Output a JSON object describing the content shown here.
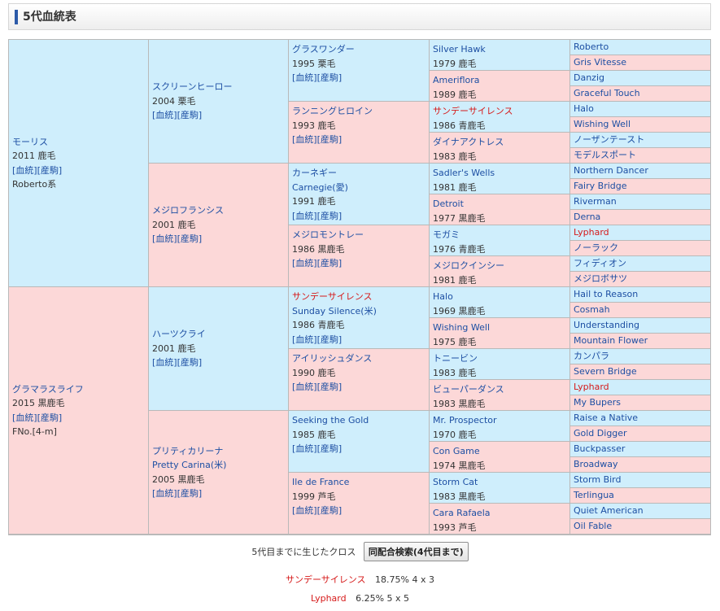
{
  "header": {
    "title": "5代血統表"
  },
  "links": {
    "ped": "[血統]",
    "prod": "[産駒]"
  },
  "gen1": [
    {
      "name": "モーリス",
      "info": "2011 鹿毛",
      "line": "Roberto系"
    },
    {
      "name": "グラマラスライフ",
      "info": "2015 黒鹿毛",
      "line": "FNo.[4-m]"
    }
  ],
  "gen2": [
    {
      "name": "スクリーンヒーロー",
      "info": "2004 栗毛"
    },
    {
      "name": "メジロフランシス",
      "info": "2001 鹿毛"
    },
    {
      "name": "ハーツクライ",
      "info": "2001 鹿毛"
    },
    {
      "name": "プリティカリーナ",
      "en": "Pretty Carina(米)",
      "info": "2005 黒鹿毛"
    }
  ],
  "gen3": [
    {
      "name": "グラスワンダー",
      "info": "1995 栗毛"
    },
    {
      "name": "ランニングヒロイン",
      "info": "1993 鹿毛"
    },
    {
      "name": "カーネギー",
      "en": "Carnegie(愛)",
      "info": "1991 鹿毛"
    },
    {
      "name": "メジロモントレー",
      "info": "1986 黒鹿毛"
    },
    {
      "name": "サンデーサイレンス",
      "en": "Sunday Silence(米)",
      "info": "1986 青鹿毛",
      "red": true
    },
    {
      "name": "アイリッシュダンス",
      "info": "1990 鹿毛"
    },
    {
      "name": "Seeking the Gold",
      "info": "1985 鹿毛"
    },
    {
      "name": "Ile de France",
      "info": "1999 芦毛"
    }
  ],
  "gen4": [
    {
      "name": "Silver Hawk",
      "info": "1979 鹿毛"
    },
    {
      "name": "Ameriflora",
      "info": "1989 鹿毛"
    },
    {
      "name": "サンデーサイレンス",
      "info": "1986 青鹿毛",
      "red": true
    },
    {
      "name": "ダイナアクトレス",
      "info": "1983 鹿毛"
    },
    {
      "name": "Sadler's Wells",
      "info": "1981 鹿毛"
    },
    {
      "name": "Detroit",
      "info": "1977 黒鹿毛"
    },
    {
      "name": "モガミ",
      "info": "1976 青鹿毛"
    },
    {
      "name": "メジロクインシー",
      "info": "1981 鹿毛"
    },
    {
      "name": "Halo",
      "info": "1969 黒鹿毛"
    },
    {
      "name": "Wishing Well",
      "info": "1975 鹿毛"
    },
    {
      "name": "トニービン",
      "info": "1983 鹿毛"
    },
    {
      "name": "ビューパーダンス",
      "info": "1983 黒鹿毛"
    },
    {
      "name": "Mr. Prospector",
      "info": "1970 鹿毛"
    },
    {
      "name": "Con Game",
      "info": "1974 黒鹿毛"
    },
    {
      "name": "Storm Cat",
      "info": "1983 黒鹿毛"
    },
    {
      "name": "Cara Rafaela",
      "info": "1993 芦毛"
    }
  ],
  "gen5": [
    {
      "name": "Roberto"
    },
    {
      "name": "Gris Vitesse"
    },
    {
      "name": "Danzig"
    },
    {
      "name": "Graceful Touch"
    },
    {
      "name": "Halo"
    },
    {
      "name": "Wishing Well"
    },
    {
      "name": "ノーザンテースト"
    },
    {
      "name": "モデルスポート"
    },
    {
      "name": "Northern Dancer"
    },
    {
      "name": "Fairy Bridge"
    },
    {
      "name": "Riverman"
    },
    {
      "name": "Derna"
    },
    {
      "name": "Lyphard",
      "red": true
    },
    {
      "name": "ノーラック"
    },
    {
      "name": "フィディオン"
    },
    {
      "name": "メジロボサツ"
    },
    {
      "name": "Hail to Reason"
    },
    {
      "name": "Cosmah"
    },
    {
      "name": "Understanding"
    },
    {
      "name": "Mountain Flower"
    },
    {
      "name": "カンパラ"
    },
    {
      "name": "Severn Bridge"
    },
    {
      "name": "Lyphard",
      "red": true
    },
    {
      "name": "My Bupers"
    },
    {
      "name": "Raise a Native"
    },
    {
      "name": "Gold Digger"
    },
    {
      "name": "Buckpasser"
    },
    {
      "name": "Broadway"
    },
    {
      "name": "Storm Bird"
    },
    {
      "name": "Terlingua"
    },
    {
      "name": "Quiet American"
    },
    {
      "name": "Oil Fable"
    }
  ],
  "cross": {
    "label": "5代目までに生じたクロス",
    "button": "同配合検索(4代目まで)",
    "items": [
      {
        "name": "サンデーサイレンス",
        "value": "18.75%  4 x 3"
      },
      {
        "name": "Lyphard",
        "value": "6.25%  5 x 5"
      }
    ]
  },
  "colors": {
    "male_bg": "#cfeefc",
    "female_bg": "#fcd8d8",
    "link": "#1d4fa3",
    "cross_red": "#d61a1a",
    "header_bar": "#2c5aa8"
  }
}
